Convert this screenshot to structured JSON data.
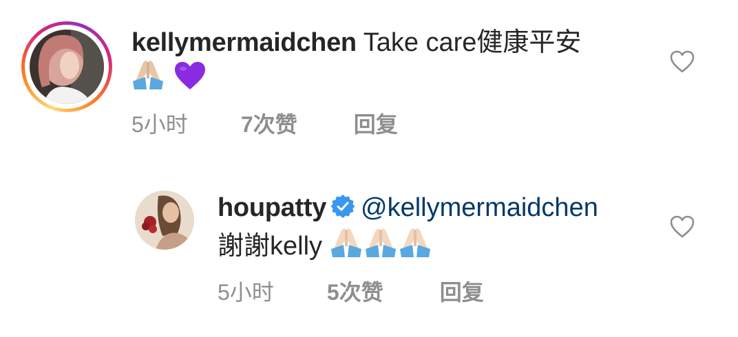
{
  "comments": [
    {
      "username": "kellymermaidchen",
      "text": "Take care健康平安",
      "emojis": [
        "folded-hands",
        "purple-heart"
      ],
      "time": "5小时",
      "likes": "7次赞",
      "reply": "回复"
    },
    {
      "username": "houpatty",
      "verified": true,
      "mention": "@kellymermaidchen",
      "text": "謝謝kelly",
      "emojis": [
        "folded-hands",
        "folded-hands",
        "folded-hands"
      ],
      "time": "5小时",
      "likes": "5次赞",
      "reply": "回复"
    }
  ],
  "colors": {
    "text": "#262626",
    "meta": "#8e8e8e",
    "mention": "#00376b",
    "verified": "#3897f0",
    "emoji_heart": "#8a2be2"
  }
}
